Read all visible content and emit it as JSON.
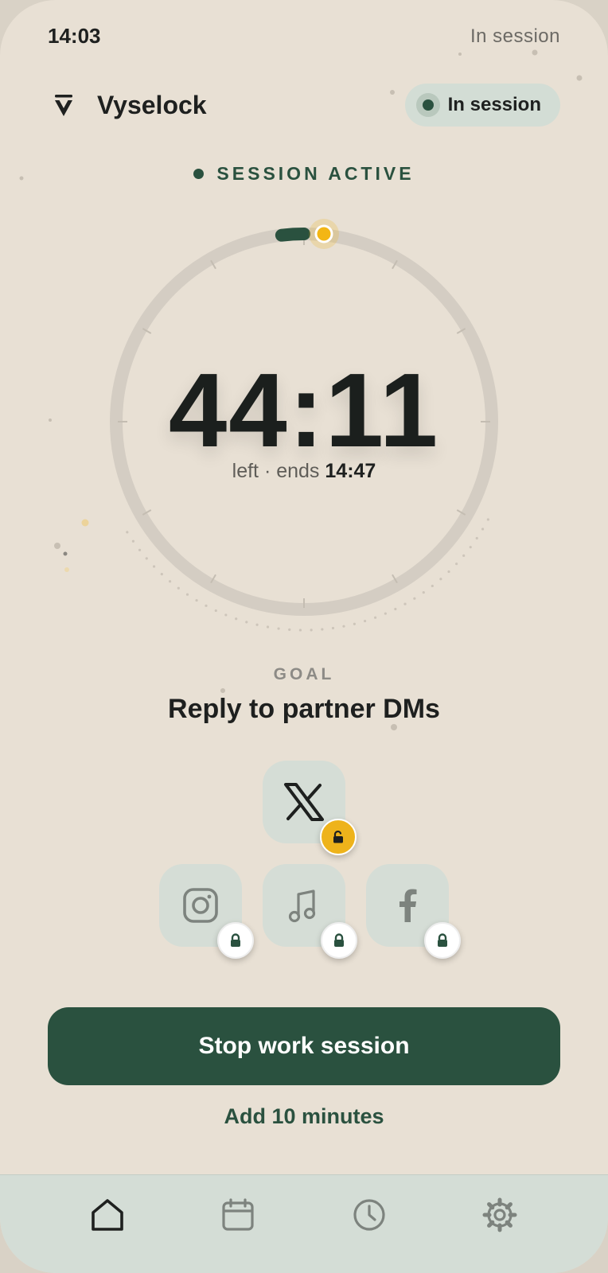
{
  "status_bar": {
    "time": "14:03",
    "status": "In session"
  },
  "header": {
    "app_name": "Vyselock",
    "pill_label": "In session"
  },
  "session": {
    "label": "SESSION ACTIVE",
    "remaining": "44:11",
    "left_text": "left · ends ",
    "ends_at": "14:47",
    "progress_fraction": 0.019
  },
  "goal": {
    "label": "GOAL",
    "text": "Reply to partner DMs"
  },
  "apps": [
    {
      "name": "x",
      "icon": "x-logo-icon",
      "state": "unlocked"
    },
    {
      "name": "instagram",
      "icon": "instagram-icon",
      "state": "locked"
    },
    {
      "name": "music",
      "icon": "music-note-icon",
      "state": "locked"
    },
    {
      "name": "facebook",
      "icon": "facebook-icon",
      "state": "locked"
    }
  ],
  "actions": {
    "stop": "Stop work session",
    "add": "Add 10 minutes"
  },
  "nav": [
    {
      "icon": "home-icon",
      "active": true
    },
    {
      "icon": "calendar-icon",
      "active": false
    },
    {
      "icon": "clock-icon",
      "active": false
    },
    {
      "icon": "gear-icon",
      "active": false
    }
  ],
  "colors": {
    "background": "#e8e0d4",
    "accent": "#2a513f",
    "highlight": "#eeb31b",
    "tile": "#d5ddd6",
    "ring": "#d4cdc3"
  }
}
